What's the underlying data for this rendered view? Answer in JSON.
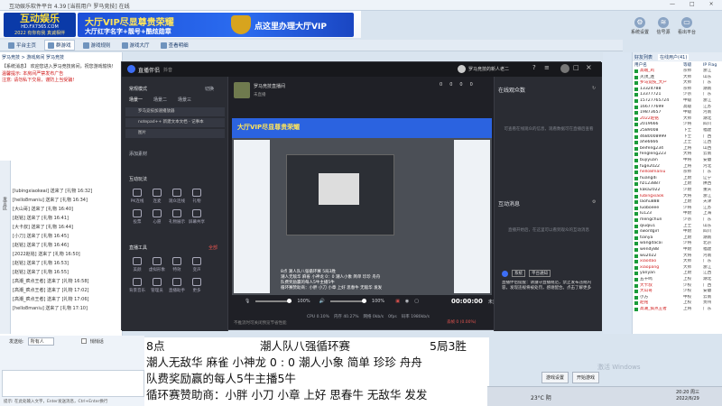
{
  "window": {
    "title": "互动娱乐软件平台 4.39 [当前用户 罗马竞技] 在线",
    "controls": [
      "—",
      "□",
      "×"
    ]
  },
  "banner": {
    "logo_main": "互动娱乐",
    "logo_sub": "HD.FX7365.COM",
    "logo_tag": "2022 有你有我 真诚相伴",
    "vip_line1": "大厅VIP尽显尊贵荣耀",
    "vip_line2": "大厅红字名字+靓号+酷炫勋章",
    "vip_line3": "点这里办理大厅VIP"
  },
  "top_buttons": [
    {
      "label": "系统设置",
      "icon": "gear-icon"
    },
    {
      "label": "信号源",
      "icon": "signal-icon"
    },
    {
      "label": "看出平台",
      "icon": "monitor-icon"
    }
  ],
  "toolbar": [
    {
      "label": "平台主页",
      "icon": "home-icon"
    },
    {
      "label": "群游戏",
      "icon": "game-icon",
      "active": true
    },
    {
      "label": "游戏规则",
      "icon": "rules-icon"
    },
    {
      "label": "游戏大厅",
      "icon": "hall-icon"
    },
    {
      "label": "查看明细",
      "icon": "list-icon"
    }
  ],
  "breadcrumb": "罗马竞技 > 游戏房间 罗马竞技",
  "chat": {
    "header": "【系统消息】 欢迎您进入罗马竞技房间，祝您游戏愉快!",
    "notices": [
      "温馨提示: 本房间严禁发布广告",
      "注意: 请勿私下交易，谨防上当受骗!"
    ],
    "lines": [
      "[lubingxiaokeai] 送来了 [礼物 16:32]",
      "[hello8maniu] 送来了 [礼物 16:34]",
      "[大山哥] 送来了 [礼物 16:40]",
      "[赵铭] 送来了 [礼物 16:41]",
      "[大卡叔] 送来了 [礼物 16:44]",
      "[小刀] 送来了 [礼物 16:45]",
      "[赵铭] 送来了 [礼物 16:46]",
      "[2022赵铭] 送来了 [礼物 16:50]",
      "[赵铭] 送来了 [礼物 16:53]",
      "[赵铭] 送来了 [礼物 16:55]",
      "[高潮_疯点王者] 送来了 [礼物 16:58]",
      "[高潮_疯点王者] 送来了 [礼物 17:02]",
      "[高潮_疯点王者] 送来了 [礼物 17:06]",
      "[hello8maniu] 送来了 [礼物 17:10]"
    ],
    "side_label": "发言区"
  },
  "input": {
    "label": "发送给:",
    "target": "所有人",
    "checkbox_label": "悄悄话",
    "send_label": "发送"
  },
  "bottom_note": "提示: 在此处输入文字，Enter发送消息，Ctrl+Enter换行",
  "obs": {
    "title": "直播伴侣",
    "sub": "抖音",
    "user": "罗马竞技的新人老二",
    "mode_label": "常规模式",
    "mode_right": "切换",
    "scene_tabs": [
      "场景一",
      "场景二",
      "场景三"
    ],
    "sources": [
      "罗马竞技加速播放器",
      "notepad++ 新建文本文档 - 记事本",
      "图片"
    ],
    "add_source": "添加素材",
    "interactive_title": "互动玩法",
    "interactive_items": [
      "PK连线",
      "连麦",
      "观众连线",
      "礼物",
      "投票",
      "心愿",
      "礼物展示",
      "屏幕共享"
    ],
    "tools_title": "直播工具",
    "tools_more": "全部",
    "tools_items": [
      "美颜",
      "虚拟形象",
      "特效",
      "变声",
      "背景音乐",
      "管理员",
      "直播助手",
      "更多"
    ],
    "stream_name": "罗马竞技直播间",
    "stream_status": "未直播",
    "stats": [
      "0",
      "0",
      "0",
      "0"
    ],
    "online_title": "在线观众数",
    "online_hint": "可查看在线观众的信息，观看数据可在直播后查看",
    "interact_title": "互动消息",
    "interact_hint": "直播开始后，在这里可以看到观众的互动消息",
    "system_tab": "系统",
    "notice_tab": "平台通知",
    "system_msg": "直播伴侣提醒：请遵守直播规范，禁止发布违规内容，发现违规将被处罚，感谢配合。点击了解更多",
    "mic": "100%",
    "speaker": "100%",
    "time": "00:00:00",
    "time_label": "未直播",
    "status": {
      "cpu": "CPU 0.10%",
      "mem": "内存 40.27%",
      "net": "网络 0kb/s",
      "fps": "0fps",
      "bitrate": "码率 1980kb/s",
      "dropped": "丢帧 0 (0.00%)"
    },
    "hint": "不推流时可关闭预览节省性能"
  },
  "preview": {
    "banner": "大厅VIP尽显尊贵荣耀",
    "overlay_lines": [
      "8点       潮人队八强循环赛      5局3胜",
      "潮人无敌华 麻雀 小神龙  0：0 潮人小象 简单 珍珍 舟舟",
      "队费奖励赢的每人5牛主播5牛",
      "循环赛赞助商：小胖 小刀 小章 上好 思春牛 无敌华 发发"
    ]
  },
  "online_list": {
    "tabs": [
      "好友列表",
      "在线用户(41)"
    ],
    "columns": [
      "用户名",
      "等级",
      "IP Flag"
    ],
    "users": [
      {
        "name": "高端_鸡",
        "lv": "宗师",
        "flag": "浙江",
        "red": true
      },
      {
        "name": "灭顶_连",
        "lv": "大师",
        "flag": "山东",
        "red": false
      },
      {
        "name": "罗马竞技_大户",
        "lv": "大师",
        "flag": "广东",
        "red": true
      },
      {
        "name": "13324788",
        "lv": "宗师",
        "flag": "湖南",
        "red": false
      },
      {
        "name": "13377721",
        "lv": "少宗",
        "flag": "广东",
        "red": false
      },
      {
        "name": "15727765724",
        "lv": "中级",
        "flag": "浙江",
        "red": false
      },
      {
        "name": "166777699",
        "lv": "高级",
        "flag": "江苏",
        "red": false
      },
      {
        "name": "19873657",
        "lv": "中级",
        "flag": "河南",
        "red": false
      },
      {
        "name": "2022赵铭",
        "lv": "大师",
        "flag": "湖北",
        "red": true
      },
      {
        "name": "2019666",
        "lv": "少将",
        "flag": "四川",
        "red": false
      },
      {
        "name": "2589008",
        "lv": "下士",
        "flag": "福建",
        "red": false
      },
      {
        "name": "4680008999",
        "lv": "下士",
        "flag": "广西",
        "red": false
      },
      {
        "name": "ahe6666",
        "lv": "上士",
        "flag": "江西",
        "red": false
      },
      {
        "name": "beifeng234",
        "lv": "上将",
        "flag": "山西",
        "red": false
      },
      {
        "name": "fengleng223",
        "lv": "大将",
        "flag": "云南",
        "red": false
      },
      {
        "name": "bujiyuan",
        "lv": "中将",
        "flag": "安徽",
        "red": false
      },
      {
        "name": "fuge2022",
        "lv": "上将",
        "flag": "河北",
        "red": false
      },
      {
        "name": "hello8maniu",
        "lv": "宗师",
        "flag": "广东",
        "red": true
      },
      {
        "name": "huangdi",
        "lv": "上尉",
        "flag": "辽宁",
        "red": false
      },
      {
        "name": "hz123887",
        "lv": "上尉",
        "flag": "陕西",
        "red": false
      },
      {
        "name": "kaka2022",
        "lv": "少尉",
        "flag": "重庆",
        "red": false
      },
      {
        "name": "lubingxiaok",
        "lv": "大将",
        "flag": "浙江",
        "red": true
      },
      {
        "name": "laohu888",
        "lv": "上尉",
        "flag": "天津",
        "red": false
      },
      {
        "name": "luoboeee",
        "lv": "少将",
        "flag": "江苏",
        "red": false
      },
      {
        "name": "lu123",
        "lv": "中尉",
        "flag": "上海",
        "red": false
      },
      {
        "name": "mengchun",
        "lv": "少宗",
        "flag": "广东",
        "red": false
      },
      {
        "name": "qiuqiu1",
        "lv": "上士",
        "flag": "山东",
        "red": false
      },
      {
        "name": "swordgirl",
        "lv": "中尉",
        "flag": "四川",
        "red": false
      },
      {
        "name": "tianya",
        "lv": "上尉",
        "flag": "湖南",
        "red": false
      },
      {
        "name": "wangdacai",
        "lv": "少将",
        "flag": "北京",
        "red": false
      },
      {
        "name": "wendy88",
        "lv": "中尉",
        "flag": "福建",
        "red": false
      },
      {
        "name": "wu2022",
        "lv": "大将",
        "flag": "河南",
        "red": false
      },
      {
        "name": "xiaodao",
        "lv": "大师",
        "flag": "广东",
        "red": true
      },
      {
        "name": "xiaopang",
        "lv": "大师",
        "flag": "浙江",
        "red": true
      },
      {
        "name": "yanyan",
        "lv": "上尉",
        "flag": "江西",
        "red": false
      },
      {
        "name": "五十鸣",
        "lv": "上校",
        "flag": "湖北",
        "red": false
      },
      {
        "name": "大卡叔",
        "lv": "少校",
        "flag": "广西",
        "red": true
      },
      {
        "name": "大山哥",
        "lv": "少校",
        "flag": "安徽",
        "red": true
      },
      {
        "name": "小方",
        "lv": "中校",
        "flag": "云南",
        "red": false
      },
      {
        "name": "赵铭",
        "lv": "上校",
        "flag": "贵州",
        "red": true
      },
      {
        "name": "高潮_疯点王者",
        "lv": "上将",
        "flag": "广东",
        "red": true
      }
    ]
  },
  "overlay": {
    "line1a": "8点",
    "line1b": "潮人队八强循环赛",
    "line1c": "5局3胜",
    "line2": "潮人无敌华 麻雀 小神龙   0 :  0 潮人小象 简单 珍珍 舟舟",
    "line3": "队费奖励赢的每人5牛主播5牛",
    "line4": "循环赛赞助商：小胖 小刀 小章 上好 思春牛 无敌华 发发"
  },
  "buttons": {
    "settings": "游戏设置",
    "start": "开始游戏"
  },
  "taskbar": {
    "weather": "23°C 阴",
    "time": "20:20 周三",
    "date": "2022/6/29",
    "watermark": "激活 Windows"
  }
}
